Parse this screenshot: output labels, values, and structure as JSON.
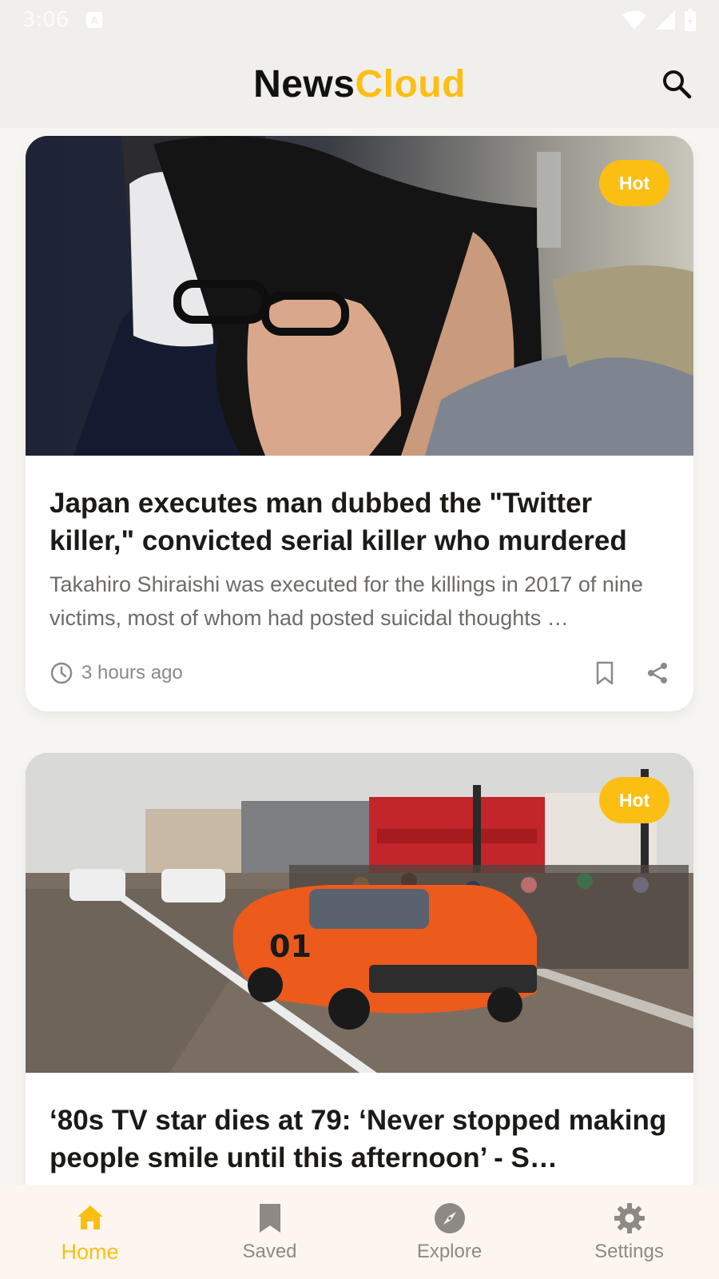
{
  "status_bar": {
    "time": "3:06",
    "notification_icon": "A"
  },
  "header": {
    "logo_part1": "News",
    "logo_part2": "Cloud",
    "search_icon": "search-icon"
  },
  "colors": {
    "accent": "#fbbf14",
    "background": "#f1efeb",
    "nav_background": "#fdf6ee",
    "title": "#1c1a17",
    "muted": "#8d8a86"
  },
  "articles": [
    {
      "badge": "Hot",
      "title": "Japan executes man dubbed the \"Twitter killer,\" convicted serial killer who murdered a…",
      "description": "Takahiro Shiraishi was executed for the killings in 2017 of nine victims, most of whom had posted suicidal thoughts …",
      "time": "3 hours ago"
    },
    {
      "badge": "Hot",
      "title": "‘80s TV star dies at 79: ‘Never stopped making people smile until this afternoon’ - S…"
    }
  ],
  "bottom_nav": [
    {
      "label": "Home",
      "icon": "home-icon",
      "active": true
    },
    {
      "label": "Saved",
      "icon": "bookmark-icon",
      "active": false
    },
    {
      "label": "Explore",
      "icon": "compass-icon",
      "active": false
    },
    {
      "label": "Settings",
      "icon": "gear-icon",
      "active": false
    }
  ]
}
